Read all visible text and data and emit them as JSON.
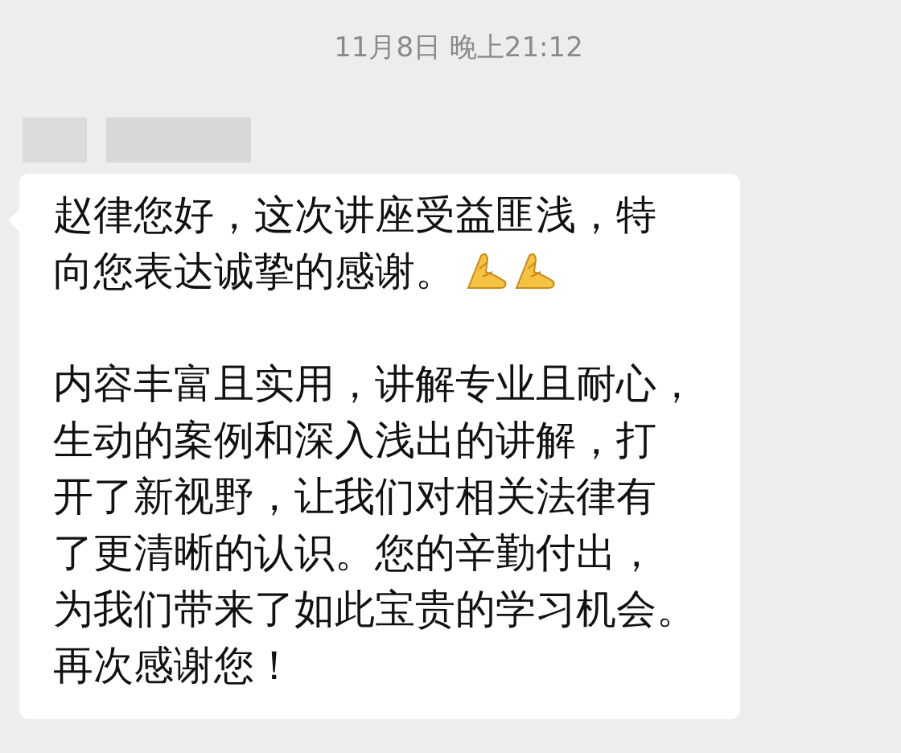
{
  "timestamp": "11月8日 晚上21:12",
  "sender": {
    "redacted": true
  },
  "message": {
    "paragraphs": [
      {
        "lines": [
          "赵律您好，这次讲座受益匪浅，特",
          "向您表达诚挚的感谢。"
        ],
        "emoji": [
          {
            "kind": "praying-hands"
          },
          {
            "kind": "praying-hands"
          }
        ]
      },
      {
        "lines": [
          "内容丰富且实用，讲解专业且耐心，",
          "生动的案例和深入浅出的讲解，打",
          "开了新视野，让我们对相关法律有",
          "了更清晰的认识。您的辛勤付出，",
          "为我们带来了如此宝贵的学习机会。",
          "再次感谢您！"
        ]
      }
    ]
  }
}
